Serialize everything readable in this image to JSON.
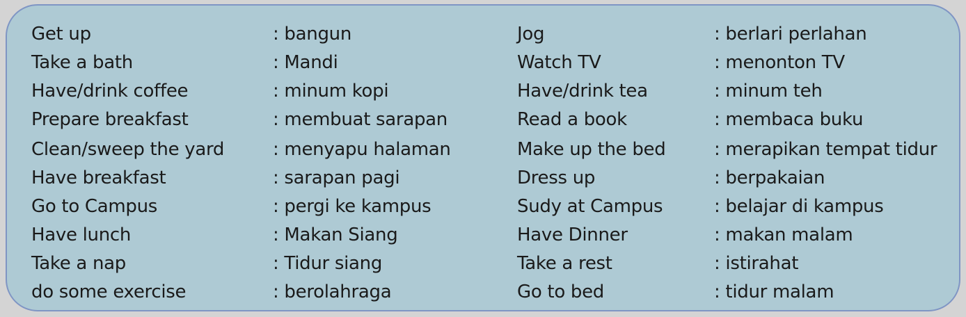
{
  "vocabulary": {
    "left": [
      {
        "english": "Get up",
        "indonesian": ": bangun"
      },
      {
        "english": "Take a bath",
        "indonesian": ": Mandi"
      },
      {
        "english": "Have/drink coffee",
        "indonesian": ": minum kopi"
      },
      {
        "english": "Prepare breakfast",
        "indonesian": ": membuat sarapan"
      },
      {
        "english": "Clean/sweep the yard",
        "indonesian": ": menyapu halaman"
      },
      {
        "english": "Have breakfast",
        "indonesian": ": sarapan pagi"
      },
      {
        "english": "Go to Campus",
        "indonesian": ": pergi ke kampus"
      },
      {
        "english": "Have lunch",
        "indonesian": ": Makan Siang"
      },
      {
        "english": "Take a nap",
        "indonesian": ": Tidur siang"
      },
      {
        "english": "do some exercise",
        "indonesian": ": berolahraga"
      }
    ],
    "right": [
      {
        "english": "Jog",
        "indonesian": ": berlari perlahan"
      },
      {
        "english": "Watch TV",
        "indonesian": ": menonton TV"
      },
      {
        "english": "Have/drink tea",
        "indonesian": ": minum teh"
      },
      {
        "english": "Read a book",
        "indonesian": ": membaca buku"
      },
      {
        "english": "Make up the bed",
        "indonesian": ": merapikan tempat tidur"
      },
      {
        "english": "Dress up",
        "indonesian": ": berpakaian"
      },
      {
        "english": "Sudy at Campus",
        "indonesian": ": belajar di kampus"
      },
      {
        "english": "Have Dinner",
        "indonesian": ": makan malam"
      },
      {
        "english": "Take a rest",
        "indonesian": ": istirahat"
      },
      {
        "english": "Go to bed",
        "indonesian": ": tidur malam"
      }
    ]
  }
}
